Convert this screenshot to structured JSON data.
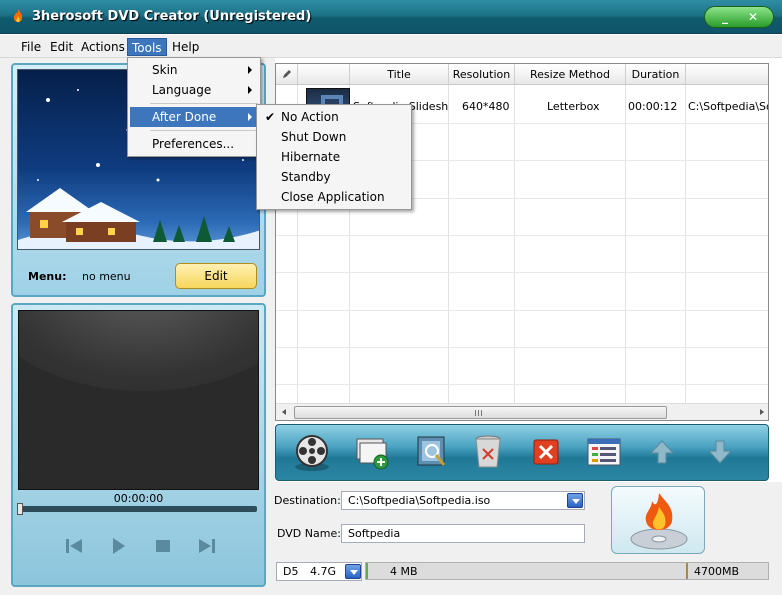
{
  "window": {
    "title": "3herosoft DVD Creator (Unregistered)",
    "minimize_glyph": "_",
    "close_glyph": "✕"
  },
  "menubar": [
    "File",
    "Edit",
    "Actions",
    "Tools",
    "Help"
  ],
  "tools_menu": {
    "items": [
      "Skin",
      "Language",
      "After Done",
      "Preferences..."
    ],
    "highlighted": "After Done"
  },
  "after_done_menu": {
    "items": [
      "No Action",
      "Shut Down",
      "Hibernate",
      "Standby",
      "Close Application"
    ],
    "checked": "No Action",
    "check_glyph": "✔"
  },
  "menu_panel": {
    "label": "Menu:",
    "value": "no menu",
    "edit_label": "Edit"
  },
  "player": {
    "time": "00:00:00"
  },
  "table": {
    "columns": [
      "",
      "",
      "Title",
      "Resolution",
      "Resize Method",
      "Duration",
      ""
    ],
    "rows": [
      {
        "title": "Softpedia Slideshow",
        "resolution": "640*480",
        "resize_method": "Letterbox",
        "duration": "00:00:12",
        "path": "C:\\Softpedia\\Softpedia"
      }
    ]
  },
  "destination": {
    "label": "Destination:",
    "value": "C:\\Softpedia\\Softpedia.iso"
  },
  "dvd_name": {
    "label": "DVD Name:",
    "value": "Softpedia"
  },
  "disc": {
    "type": "D5",
    "capacity": "4.7G",
    "used": "4 MB",
    "max": "4700MB",
    "used_fraction": 0.001
  },
  "colors": {
    "accent": "#3d76bd",
    "title_bar": "#1d7388"
  }
}
